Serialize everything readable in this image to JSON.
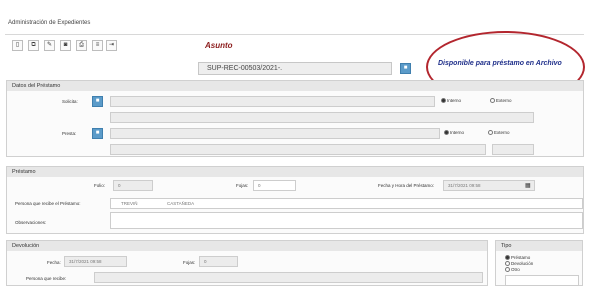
{
  "window": {
    "title": "Administración de Expedientes"
  },
  "toolbar": {
    "buttons": [
      {
        "icon": "new-document-icon",
        "glyph": "▯"
      },
      {
        "icon": "copy-icon",
        "glyph": "⧉"
      },
      {
        "icon": "edit-icon",
        "glyph": "✎"
      },
      {
        "icon": "binoculars-icon",
        "glyph": "◙"
      },
      {
        "icon": "print-icon",
        "glyph": "⎙"
      },
      {
        "icon": "list-icon",
        "glyph": "≡"
      },
      {
        "icon": "exit-icon",
        "glyph": "⇥"
      }
    ]
  },
  "header": {
    "asunto_label": "Asunto",
    "expediente": "SUP-REC-00503/2021-.",
    "status": "Disponible para préstamo en Archivo",
    "search_glyph": "■"
  },
  "datos_prestamo": {
    "section_title": "Datos del Préstamo",
    "solicita_label": "Solicita:",
    "presta_label": "Presta:",
    "interno": "Interno",
    "externo": "Externo",
    "btn_glyph": "■"
  },
  "prestamo": {
    "section_title": "Préstamo",
    "folio_label": "Folio:",
    "folio_value": "0",
    "fojas_label": "Fojas:",
    "fojas_value": "0",
    "fecha_label": "Fecha y Hora del Préstamo:",
    "fecha_value": "31/7/2021 09:58",
    "persona_label": "Persona que recibe el Préstamo:",
    "persona_first": "TREVIÑ",
    "persona_last": "CASTAÑEDA",
    "observaciones_label": "Observaciones:",
    "calendar_glyph": "▦"
  },
  "devolucion": {
    "section_title": "Devolución",
    "fecha_label": "Fecha:",
    "fecha_value": "31/7/2021 09:58",
    "fojas_label": "Fojas:",
    "fojas_value": "0",
    "persona_label": "Persona que recibe:"
  },
  "tipo": {
    "section_title": "Tipo",
    "options": [
      "Préstamo",
      "Devolución",
      "Otro"
    ]
  }
}
